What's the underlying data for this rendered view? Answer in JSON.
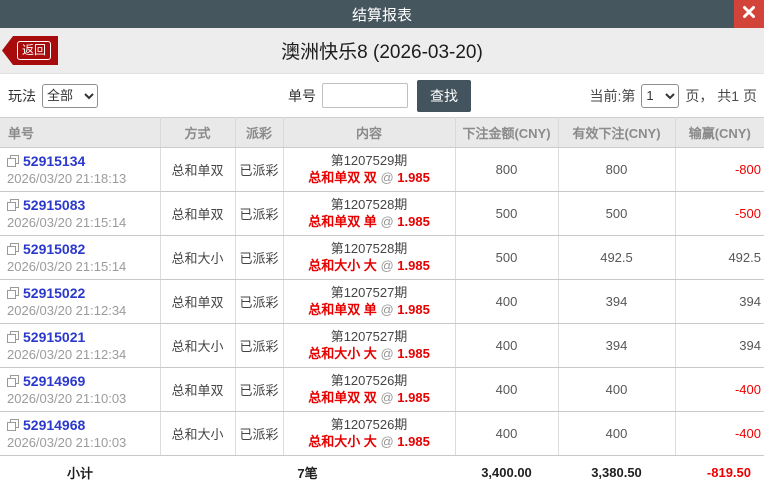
{
  "modal": {
    "title": "结算报表"
  },
  "header": {
    "back_label": "返回",
    "title": "澳洲快乐8 (2026-03-20)"
  },
  "filters": {
    "play_label": "玩法",
    "play_value": "全部",
    "order_label": "单号",
    "order_value": "",
    "search_label": "查找",
    "page_prefix": "当前:第",
    "page_value": "1",
    "page_suffix": "页， 共1 页"
  },
  "icons": {
    "close": "close-x",
    "back": "left-arrow",
    "copy": "copy-document"
  },
  "colors": {
    "topbar": "#46565f",
    "close_red": "#d2443a",
    "back_red": "#a80b0b",
    "button_slate": "#44545e",
    "link_blue": "#2b38cd",
    "bet_red": "#e60000",
    "loss_red": "#ee0000",
    "header_gray": "#e9e9e9"
  },
  "table": {
    "at_label": "@",
    "columns": [
      "单号",
      "方式",
      "派彩",
      "内容",
      "下注金额(CNY)",
      "有效下注(CNY)",
      "输赢(CNY)"
    ],
    "rows": [
      {
        "order_no": "52915134",
        "time": "2026/03/20 21:18:13",
        "method": "总和单双",
        "payout_status": "已派彩",
        "period": "第1207529期",
        "bet": "总和单双 双",
        "odds": "1.985",
        "amount": "800",
        "valid": "800",
        "winloss": "-800"
      },
      {
        "order_no": "52915083",
        "time": "2026/03/20 21:15:14",
        "method": "总和单双",
        "payout_status": "已派彩",
        "period": "第1207528期",
        "bet": "总和单双 单",
        "odds": "1.985",
        "amount": "500",
        "valid": "500",
        "winloss": "-500"
      },
      {
        "order_no": "52915082",
        "time": "2026/03/20 21:15:14",
        "method": "总和大小",
        "payout_status": "已派彩",
        "period": "第1207528期",
        "bet": "总和大小 大",
        "odds": "1.985",
        "amount": "500",
        "valid": "492.5",
        "winloss": "492.5"
      },
      {
        "order_no": "52915022",
        "time": "2026/03/20 21:12:34",
        "method": "总和单双",
        "payout_status": "已派彩",
        "period": "第1207527期",
        "bet": "总和单双 单",
        "odds": "1.985",
        "amount": "400",
        "valid": "394",
        "winloss": "394"
      },
      {
        "order_no": "52915021",
        "time": "2026/03/20 21:12:34",
        "method": "总和大小",
        "payout_status": "已派彩",
        "period": "第1207527期",
        "bet": "总和大小 大",
        "odds": "1.985",
        "amount": "400",
        "valid": "394",
        "winloss": "394"
      },
      {
        "order_no": "52914969",
        "time": "2026/03/20 21:10:03",
        "method": "总和单双",
        "payout_status": "已派彩",
        "period": "第1207526期",
        "bet": "总和单双 双",
        "odds": "1.985",
        "amount": "400",
        "valid": "400",
        "winloss": "-400"
      },
      {
        "order_no": "52914968",
        "time": "2026/03/20 21:10:03",
        "method": "总和大小",
        "payout_status": "已派彩",
        "period": "第1207526期",
        "bet": "总和大小 大",
        "odds": "1.985",
        "amount": "400",
        "valid": "400",
        "winloss": "-400"
      }
    ],
    "footer": {
      "label": "小计",
      "count": "7笔",
      "amount": "3,400.00",
      "valid": "3,380.50",
      "winloss": "-819.50"
    }
  }
}
